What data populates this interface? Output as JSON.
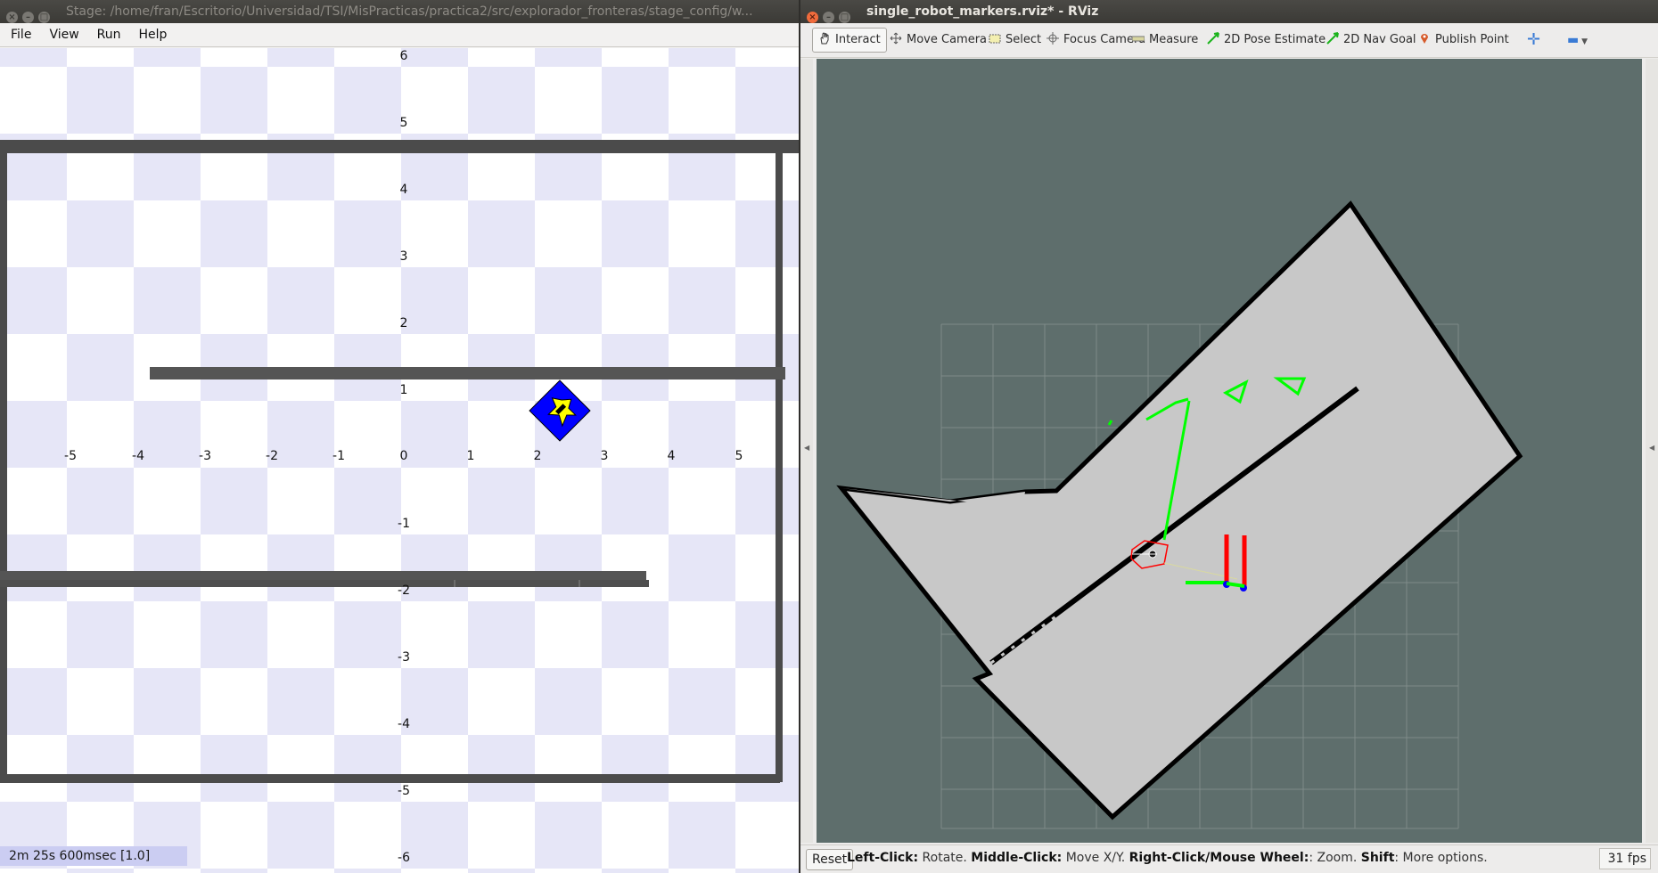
{
  "stage": {
    "title": "Stage: /home/fran/Escritorio/Universidad/TSI/MisPracticas/practica2/src/explorador_fronteras/stage_config/w...",
    "menu": [
      "File",
      "View",
      "Run",
      "Help"
    ],
    "x_ticks": [
      "-5",
      "-4",
      "-3",
      "-2",
      "-1",
      "0",
      "1",
      "2",
      "3",
      "4",
      "5"
    ],
    "y_ticks": [
      "6",
      "5",
      "4",
      "3",
      "2",
      "1",
      "-1",
      "-2",
      "-3",
      "-4",
      "-5",
      "-6"
    ],
    "sim_time": "2m 25s 600msec [1.0]",
    "robot_color": "#0000ff",
    "robot_face_color": "#ffff00"
  },
  "rviz": {
    "title": "single_robot_markers.rviz* - RViz",
    "tools": [
      {
        "label": "Interact",
        "icon": "hand-icon"
      },
      {
        "label": "Move Camera",
        "icon": "move-camera-icon"
      },
      {
        "label": "Select",
        "icon": "select-icon"
      },
      {
        "label": "Focus Camera",
        "icon": "focus-camera-icon"
      },
      {
        "label": "Measure",
        "icon": "measure-icon"
      },
      {
        "label": "2D Pose Estimate",
        "icon": "pose-estimate-icon"
      },
      {
        "label": "2D Nav Goal",
        "icon": "nav-goal-icon"
      },
      {
        "label": "Publish Point",
        "icon": "publish-point-icon"
      }
    ],
    "reset_label": "Reset",
    "hint": {
      "left_click_key": "Left-Click:",
      "left_click_val": " Rotate. ",
      "middle_click_key": "Middle-Click:",
      "middle_click_val": " Move X/Y. ",
      "right_click_key": "Right-Click/Mouse Wheel:",
      "right_click_val": ": Zoom. ",
      "shift_key": "Shift",
      "shift_val": ": More options."
    },
    "fps": "31 fps",
    "background_color": "#5e6e6c",
    "map_free_color": "#c8c8c8",
    "frontier_color": "#00ff00"
  }
}
